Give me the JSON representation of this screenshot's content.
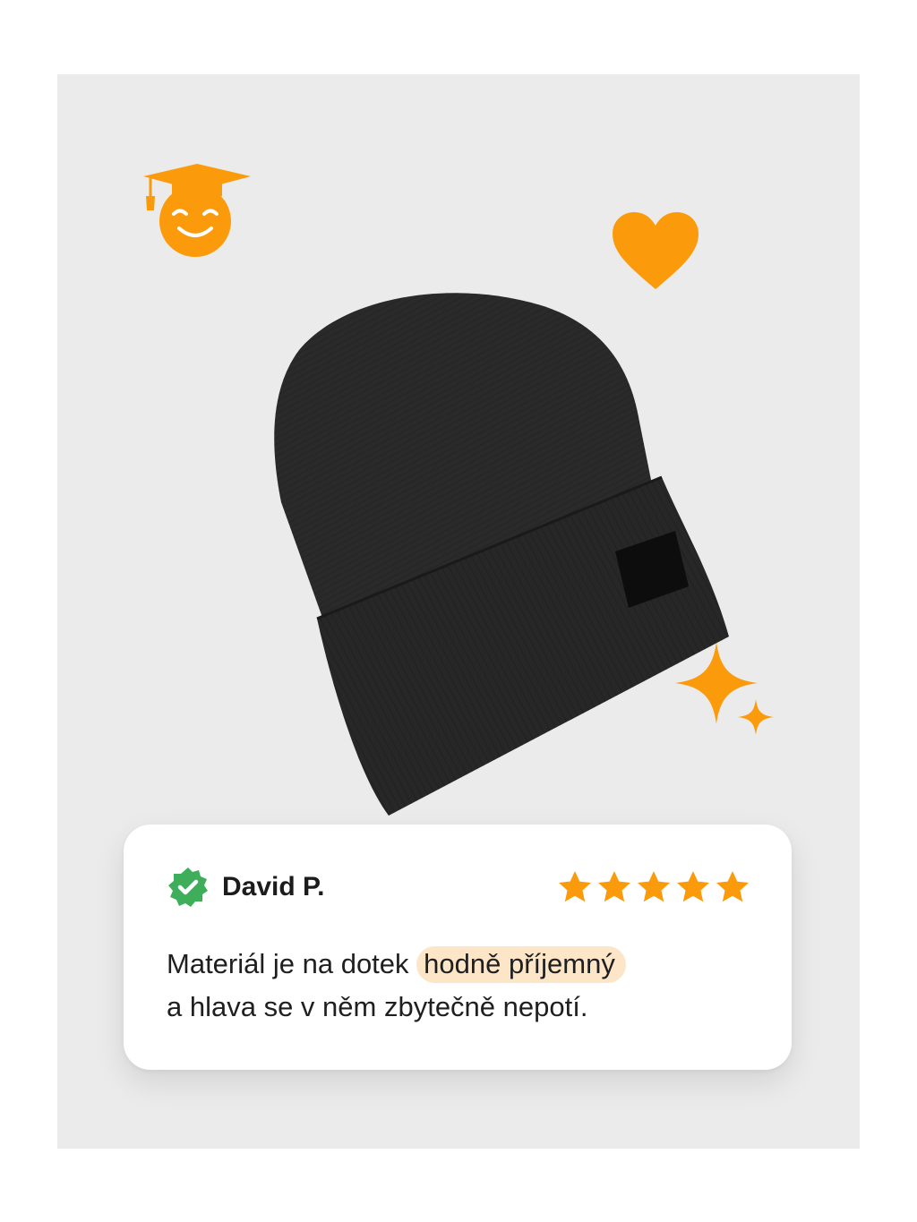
{
  "review": {
    "author": "David P.",
    "rating": 5,
    "rating_max": 5,
    "text_before": "Materiál je na dotek ",
    "text_highlight": "hodně příjemný",
    "text_after": "a hlava se v něm zbytečně nepotí."
  },
  "decorations": [
    "graduation-smiley-icon",
    "heart-icon",
    "sparkle-icon"
  ],
  "product_image": "black-beanie-with-patch",
  "colors": {
    "accent": "#fb9a0b",
    "verified": "#3fae5a",
    "highlight": "#fde6c8",
    "panel_background": "#ebebeb",
    "card_background": "#ffffff"
  }
}
